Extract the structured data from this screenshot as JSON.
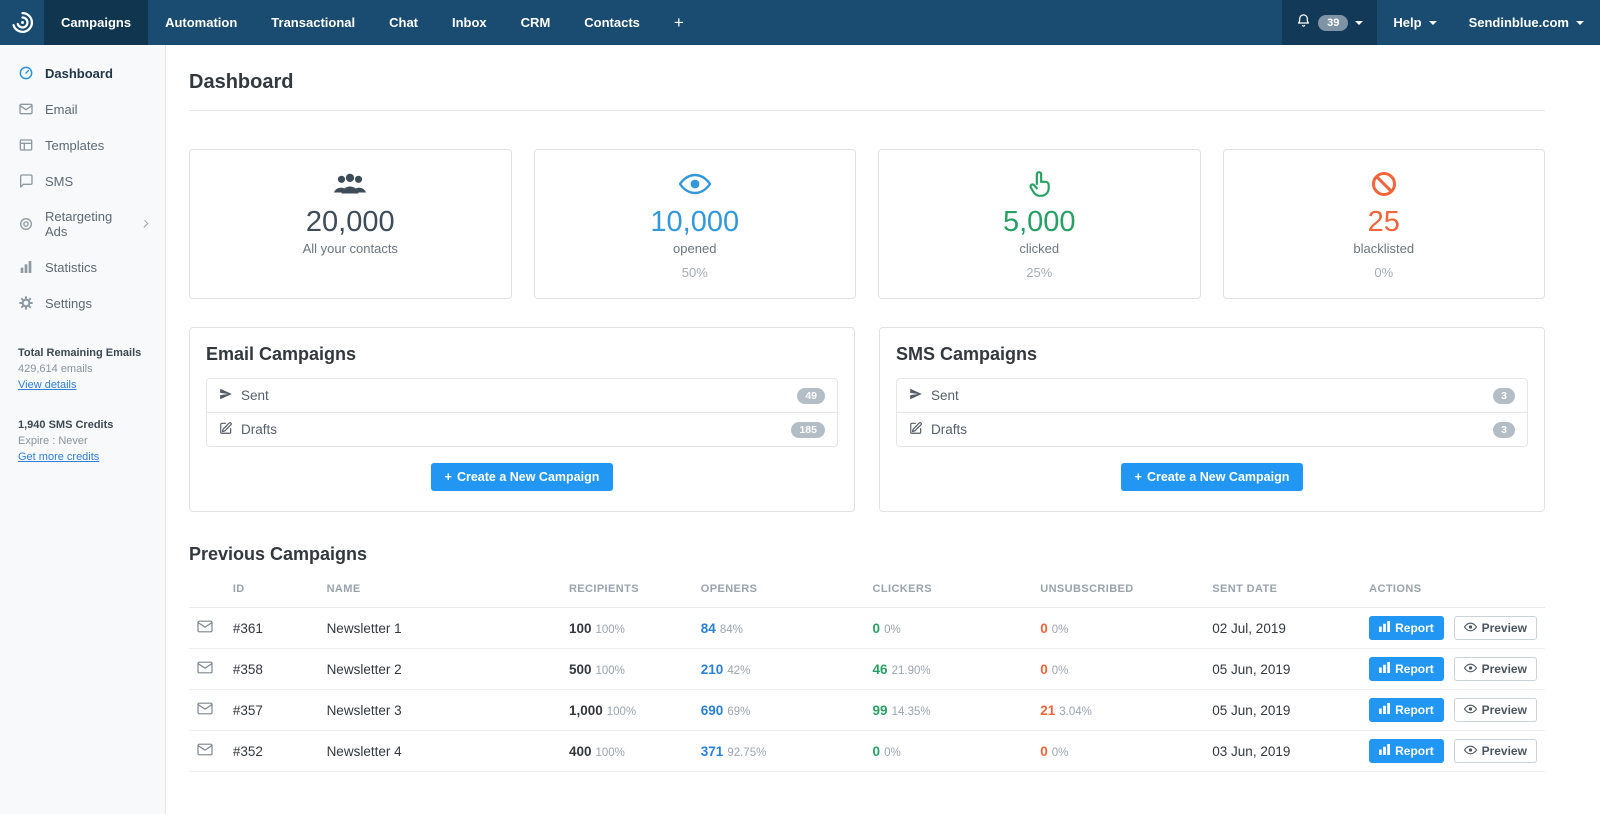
{
  "topnav": {
    "items": [
      "Campaigns",
      "Automation",
      "Transactional",
      "Chat",
      "Inbox",
      "CRM",
      "Contacts"
    ],
    "plus": "+",
    "notif_count": "39",
    "help": "Help",
    "account": "Sendinblue.com"
  },
  "sidebar": {
    "items": [
      {
        "label": "Dashboard"
      },
      {
        "label": "Email"
      },
      {
        "label": "Templates"
      },
      {
        "label": "SMS"
      },
      {
        "label": "Retargeting Ads"
      },
      {
        "label": "Statistics"
      },
      {
        "label": "Settings"
      }
    ],
    "emails_title": "Total Remaining Emails",
    "emails_value": "429,614 emails",
    "emails_link": "View details",
    "sms_title": "1,940 SMS Credits",
    "sms_sub": "Expire : Never",
    "sms_link": "Get more credits"
  },
  "main": {
    "title": "Dashboard",
    "stats": [
      {
        "value": "20,000",
        "label": "All your contacts",
        "pct": ""
      },
      {
        "value": "10,000",
        "label": "opened",
        "pct": "50%"
      },
      {
        "value": "5,000",
        "label": "clicked",
        "pct": "25%"
      },
      {
        "value": "25",
        "label": "blacklisted",
        "pct": "0%"
      }
    ],
    "email_campaigns": {
      "title": "Email Campaigns",
      "sent_label": "Sent",
      "sent_count": "49",
      "drafts_label": "Drafts",
      "drafts_count": "185",
      "create_button": "Create a New Campaign"
    },
    "sms_campaigns": {
      "title": "SMS Campaigns",
      "sent_label": "Sent",
      "sent_count": "3",
      "drafts_label": "Drafts",
      "drafts_count": "3",
      "create_button": "Create a New Campaign"
    },
    "previous": {
      "title": "Previous Campaigns",
      "columns": {
        "id": "ID",
        "name": "NAME",
        "recipients": "RECIPIENTS",
        "openers": "OPENERS",
        "clickers": "CLICKERS",
        "unsubscribed": "UNSUBSCRIBED",
        "sent_date": "SENT DATE",
        "actions": "ACTIONS"
      },
      "report_label": "Report",
      "preview_label": "Preview",
      "rows": [
        {
          "id": "#361",
          "name": "Newsletter 1",
          "recipients": "100",
          "recipients_pct": "100%",
          "openers": "84",
          "openers_pct": "84%",
          "clickers": "0",
          "clickers_pct": "0%",
          "unsubscribed": "0",
          "unsubscribed_pct": "0%",
          "sent_date": "02 Jul, 2019"
        },
        {
          "id": "#358",
          "name": "Newsletter 2",
          "recipients": "500",
          "recipients_pct": "100%",
          "openers": "210",
          "openers_pct": "42%",
          "clickers": "46",
          "clickers_pct": "21.90%",
          "unsubscribed": "0",
          "unsubscribed_pct": "0%",
          "sent_date": "05 Jun, 2019"
        },
        {
          "id": "#357",
          "name": "Newsletter 3",
          "recipients": "1,000",
          "recipients_pct": "100%",
          "openers": "690",
          "openers_pct": "69%",
          "clickers": "99",
          "clickers_pct": "14.35%",
          "unsubscribed": "21",
          "unsubscribed_pct": "3.04%",
          "sent_date": "05 Jun, 2019"
        },
        {
          "id": "#352",
          "name": "Newsletter 4",
          "recipients": "400",
          "recipients_pct": "100%",
          "openers": "371",
          "openers_pct": "92.75%",
          "clickers": "0",
          "clickers_pct": "0%",
          "unsubscribed": "0",
          "unsubscribed_pct": "0%",
          "sent_date": "03 Jun, 2019"
        }
      ]
    }
  },
  "colors": {
    "navbar": "#1a4b70",
    "navbar_active": "#10354f",
    "accent_blue": "#2196f3",
    "stat_blue": "#3298db",
    "stat_green": "#27a163",
    "stat_orange": "#f0653b"
  }
}
